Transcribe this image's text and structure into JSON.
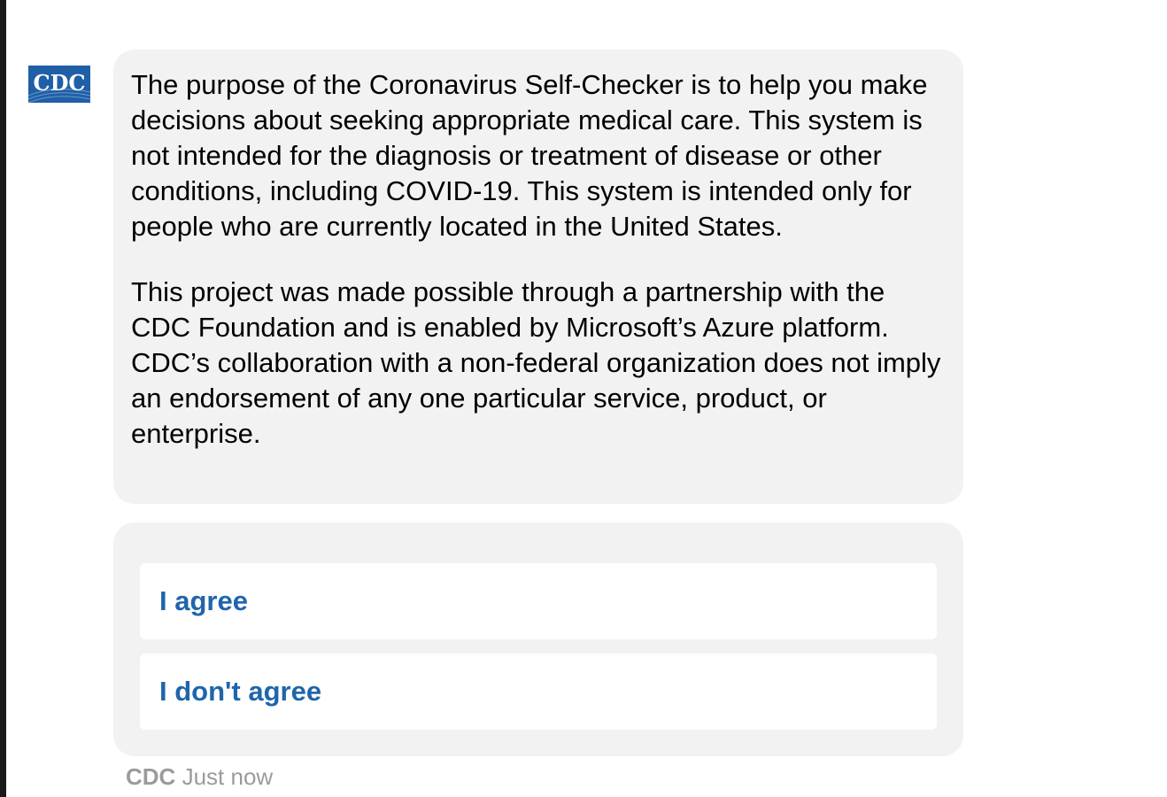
{
  "avatar": {
    "text": "CDC",
    "color": "#1f5fa8"
  },
  "message": {
    "paragraphs": [
      "The purpose of the Coronavirus Self-Checker is to help you make decisions about seeking appropriate medical care. This system is not intended for the diagnosis or treatment of disease or other conditions, including COVID-19. This system is intended only for people who are currently located in the United States.",
      "This project was made possible through a partnership with the CDC Foundation and is enabled by Microsoft’s Azure platform. CDC’s collaboration with a non-federal organization does not imply an endorsement of any one particular service, product, or enterprise."
    ]
  },
  "choices": {
    "agree_label": "I agree",
    "disagree_label": "I don't agree"
  },
  "meta": {
    "sender": "CDC",
    "timestamp": "Just now"
  },
  "colors": {
    "bubble_bg": "#f2f2f2",
    "choice_text": "#1f65ac",
    "meta_text": "#9b9b9b"
  }
}
